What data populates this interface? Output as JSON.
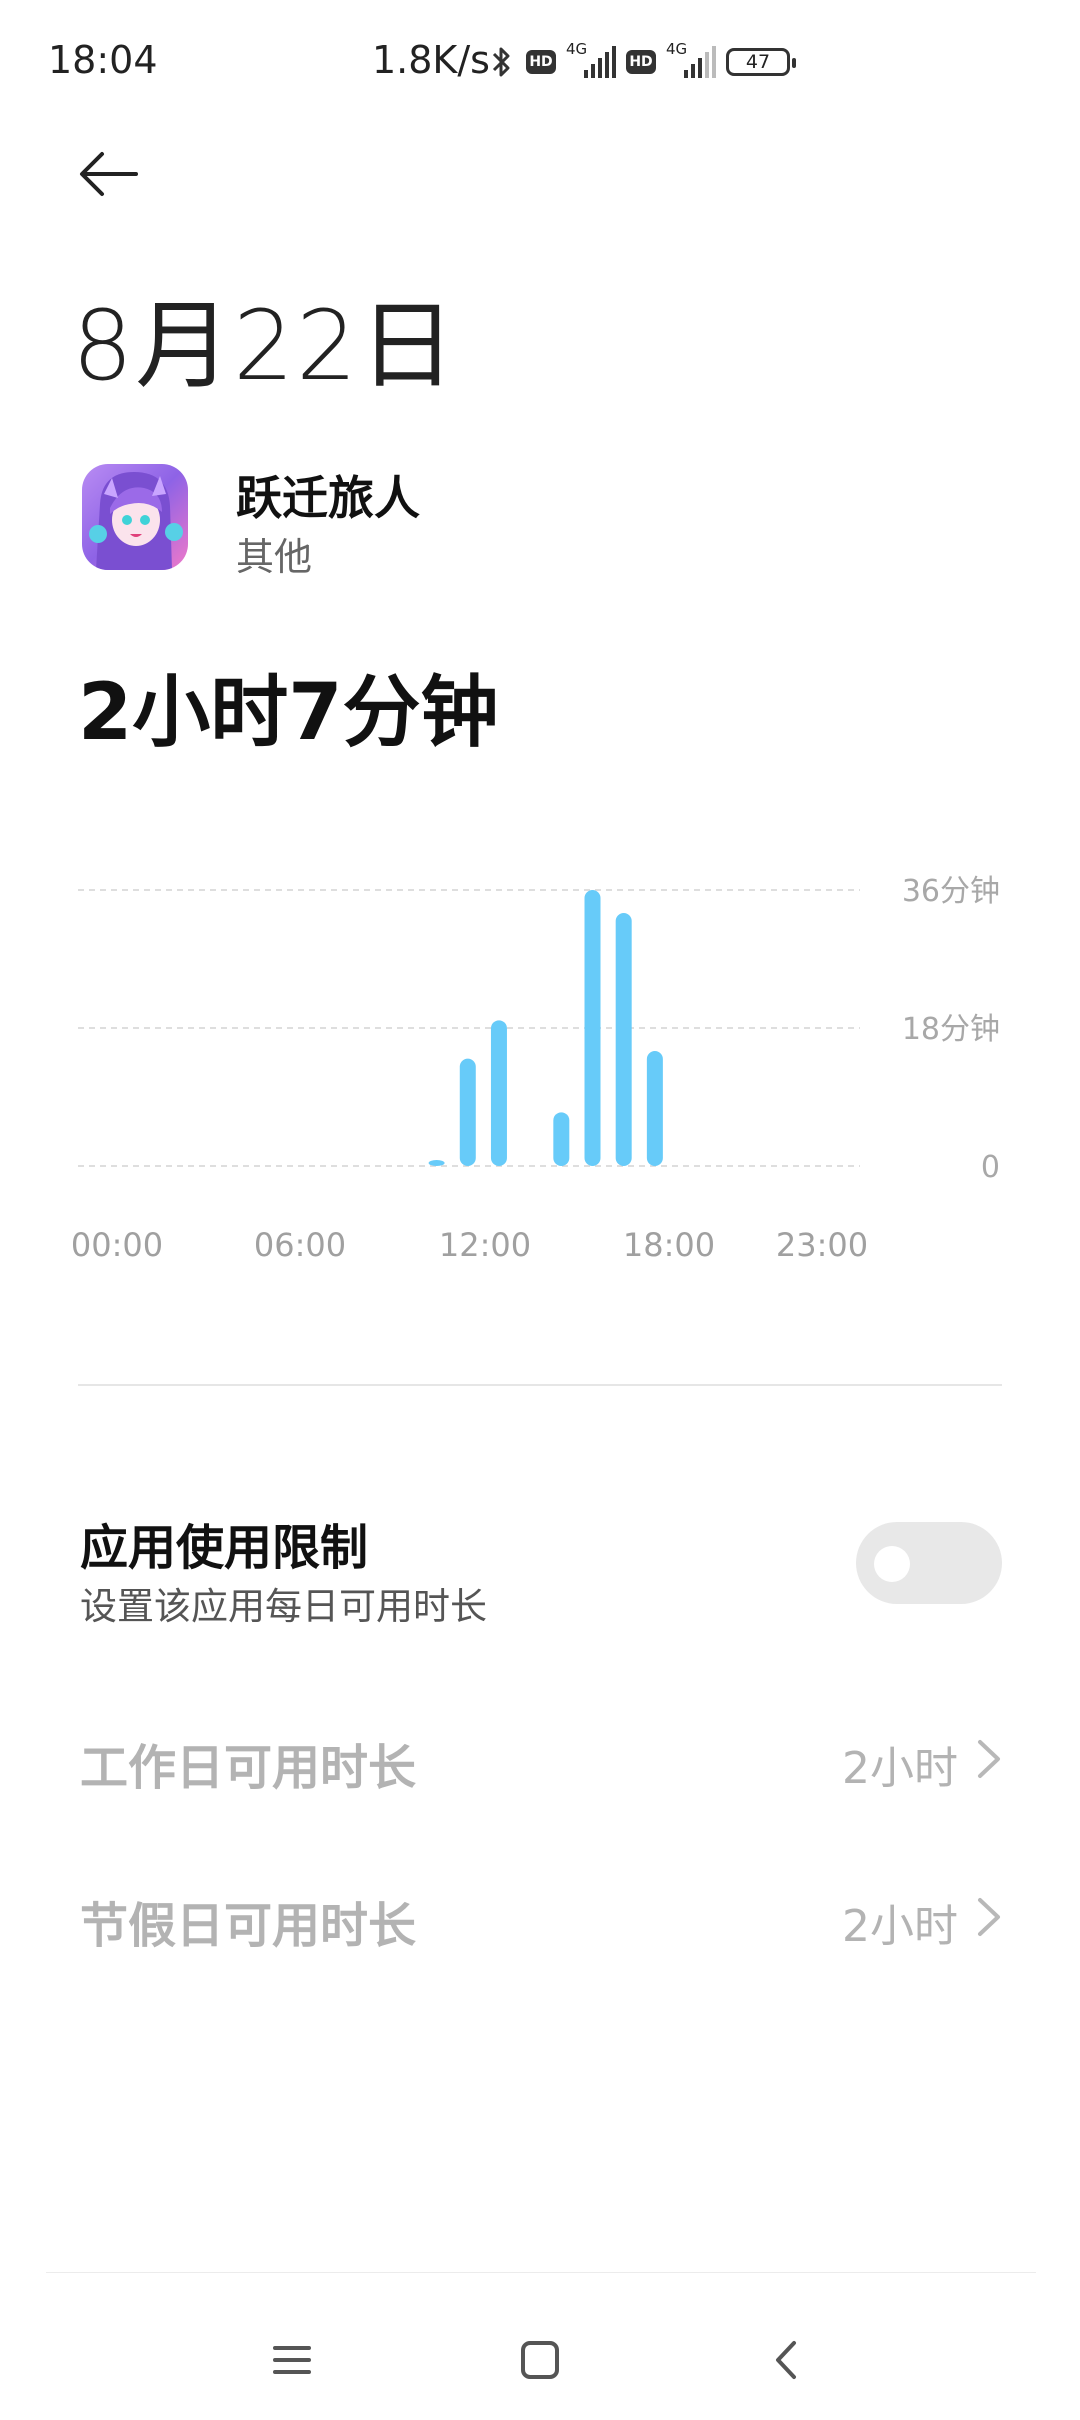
{
  "status_bar": {
    "time": "18:04",
    "net_speed": "1.8K/s",
    "hd_label": "HD",
    "signal_label": "4G",
    "battery": "47"
  },
  "header": {
    "title": "8月22日"
  },
  "app": {
    "name": "跃迁旅人",
    "category": "其他"
  },
  "total_usage": "2小时7分钟",
  "chart_data": {
    "type": "bar",
    "x_ticks": [
      "00:00",
      "06:00",
      "12:00",
      "18:00",
      "23:00"
    ],
    "y_ticks": [
      "36分钟",
      "18分钟",
      "0"
    ],
    "ylim": [
      0,
      36
    ],
    "ylabel_unit": "分钟",
    "color": "#67CBF9",
    "grid": true,
    "hours": [
      11,
      12,
      13,
      15,
      16,
      17,
      18
    ],
    "values": [
      0.5,
      14,
      19,
      7,
      36,
      33,
      15
    ]
  },
  "limit": {
    "title": "应用使用限制",
    "subtitle": "设置该应用每日可用时长",
    "enabled": false
  },
  "rows": [
    {
      "label": "工作日可用时长",
      "value": "2小时"
    },
    {
      "label": "节假日可用时长",
      "value": "2小时"
    }
  ],
  "accent_color": "#67CBF9"
}
